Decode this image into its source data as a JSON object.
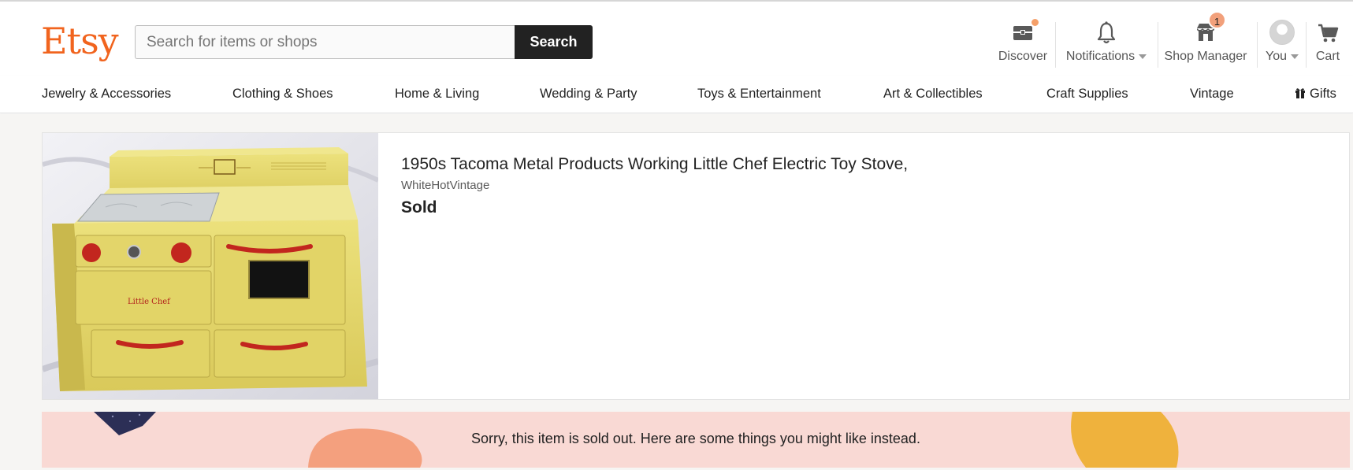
{
  "header": {
    "logo": "Etsy",
    "search": {
      "placeholder": "Search for items or shops",
      "value": "",
      "button_label": "Search"
    },
    "nav": {
      "discover": "Discover",
      "notifications": "Notifications",
      "shop_manager": "Shop Manager",
      "shop_manager_badge": "1",
      "you": "You",
      "cart": "Cart"
    }
  },
  "categories": [
    "Jewelry & Accessories",
    "Clothing & Shoes",
    "Home & Living",
    "Wedding & Party",
    "Toys & Entertainment",
    "Art & Collectibles",
    "Craft Supplies",
    "Vintage",
    "Gifts"
  ],
  "listing": {
    "title": "1950s Tacoma Metal Products Working Little Chef Electric Toy Stove,",
    "shop": "WhiteHotVintage",
    "status": "Sold",
    "stove_logo": "Little Chef"
  },
  "banner": {
    "message": "Sorry, this item is sold out. Here are some things you might like instead."
  },
  "colors": {
    "brand": "#f1641e",
    "banner_bg": "#f9d9d4",
    "notification_dot": "#f5a06a",
    "badge": "#f2a07b"
  }
}
